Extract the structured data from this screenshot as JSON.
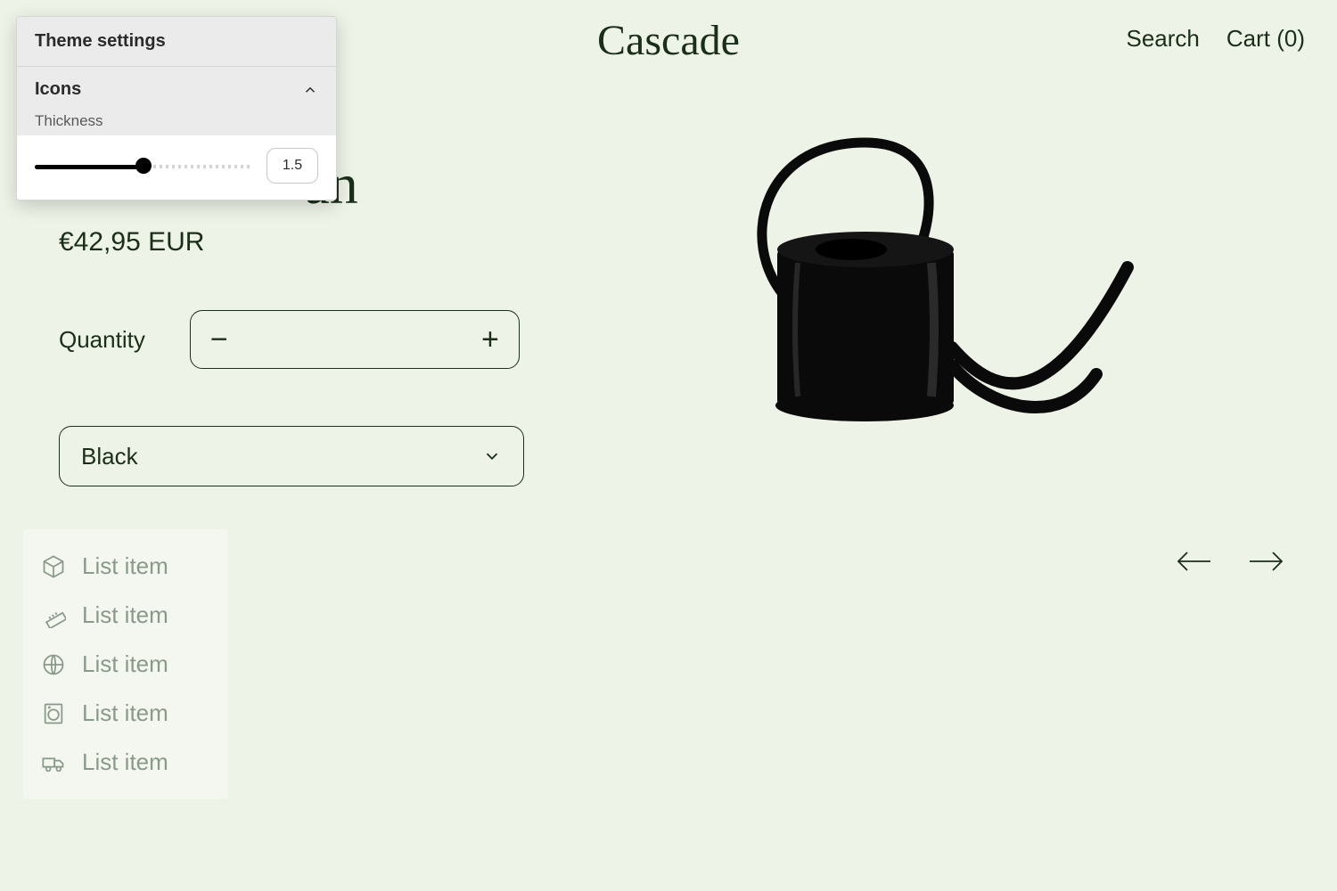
{
  "header": {
    "brand": "Cascade",
    "search_label": "Search",
    "cart_label": "Cart (0)"
  },
  "product": {
    "title_fragment": "an",
    "price": "€42,95 EUR",
    "quantity_label": "Quantity",
    "variant_selected": "Black"
  },
  "list": {
    "items": [
      {
        "icon": "package-icon",
        "label": "List item"
      },
      {
        "icon": "ruler-icon",
        "label": "List item"
      },
      {
        "icon": "globe-icon",
        "label": "List item"
      },
      {
        "icon": "washer-icon",
        "label": "List item"
      },
      {
        "icon": "truck-icon",
        "label": "List item"
      }
    ]
  },
  "settings": {
    "panel_title": "Theme settings",
    "section_title": "Icons",
    "thickness_label": "Thickness",
    "thickness_value": "1.5"
  }
}
